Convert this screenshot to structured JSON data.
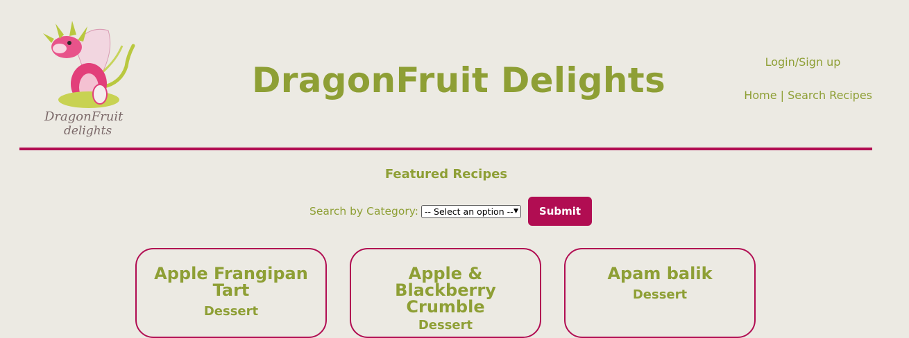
{
  "header": {
    "site_title": "DragonFruit Delights",
    "logo_text_line1": "DragonFruit",
    "logo_text_line2": "delights",
    "login_label": "Login/Sign up",
    "nav_home": "Home",
    "nav_separator": "|",
    "nav_search": "Search Recipes"
  },
  "main": {
    "section_title": "Featured Recipes",
    "search_label": "Search by Category:",
    "select_value": "-- Select an option --",
    "submit_label": "Submit",
    "recipes": [
      {
        "name": "Apple Frangipan Tart",
        "category": "Dessert"
      },
      {
        "name": "Apple & Blackberry Crumble",
        "category": "Dessert"
      },
      {
        "name": "Apam balik",
        "category": "Dessert"
      }
    ]
  },
  "colors": {
    "accent": "#B10D52",
    "brand_text": "#8E9F35",
    "background": "#ECEAE3"
  }
}
